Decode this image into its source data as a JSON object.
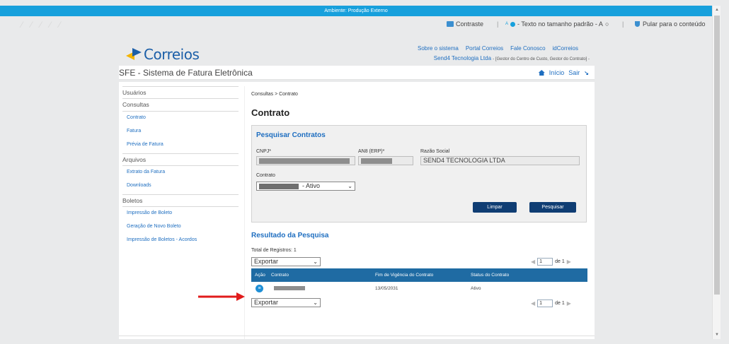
{
  "env_banner": "Ambiente: Produção Externo",
  "top_bar": {
    "contrast_label": "Contraste",
    "font_size_small": "A",
    "font_size_label": "- Texto no tamanho padrão - A",
    "font_size_reset_icon": "circle-icon",
    "skip_label": "Pular para o conteúdo"
  },
  "logo_text": "Correios",
  "header_links": [
    "Sobre o sistema",
    "Portal Correios",
    "Fale Conosco",
    "idCorreios"
  ],
  "user": {
    "company": "Send4 Tecnologia Ltda",
    "role": "- [Gestor do Centro de Custo, Gestor do Contrato] -"
  },
  "system_title": "SFE - Sistema de Fatura Eletrônica",
  "nav": {
    "home": "Início",
    "exit": "Sair"
  },
  "sidebar": {
    "usuarios": "Usuários",
    "consultas": "Consultas",
    "consultas_items": [
      "Contrato",
      "Fatura",
      "Prévia de Fatura"
    ],
    "arquivos": "Arquivos",
    "arquivos_items": [
      "Extrato da Fatura",
      "Downloads"
    ],
    "boletos": "Boletos",
    "boletos_items": [
      "Impressão de Boleto",
      "Geração de Novo Boleto",
      "Impressão de Boletos - Acordos"
    ]
  },
  "breadcrumb": "Consultas > Contrato",
  "page_title": "Contrato",
  "search": {
    "title": "Pesquisar Contratos",
    "cnpj_label": "CNPJ*",
    "an8_label": "AN8 (ERP)*",
    "razao_label": "Razão Social",
    "razao_value": "SEND4 TECNOLOGIA LTDA",
    "contrato_label": "Contrato",
    "contrato_value": "- Ativo",
    "clear_button": "Limpar",
    "search_button": "Pesquisar"
  },
  "results": {
    "title": "Resultado da Pesquisa",
    "total": "Total de Registros: 1",
    "export_label": "Exportar",
    "page_value": "1",
    "page_of": "de 1",
    "columns": [
      "Ação",
      "Contrato",
      "Fim de Vigência do Contrato",
      "Status do Contrato"
    ],
    "rows": [
      {
        "fim_vigencia": "13/05/2031",
        "status": "Ativo"
      }
    ]
  }
}
